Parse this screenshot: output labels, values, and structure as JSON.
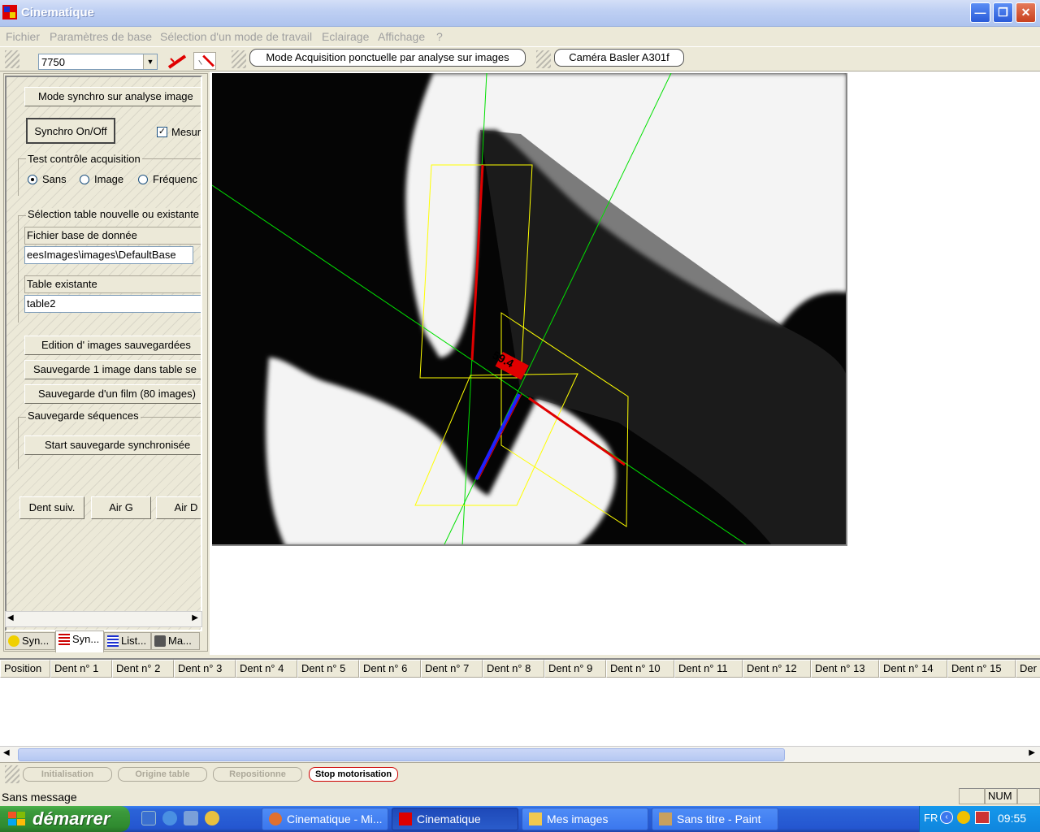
{
  "window": {
    "title": "Cinematique"
  },
  "menu": [
    "Fichier",
    "Paramètres de base",
    "Sélection d'un mode de travail",
    "Eclairage",
    "Affichage",
    "?"
  ],
  "toolbar": {
    "combo_value": "7750",
    "mode_button": "Mode Acquisition ponctuelle par analyse sur images",
    "camera_button": "Caméra Basler A301f"
  },
  "left_panel": {
    "mode_synchro_button": "Mode synchro sur analyse image",
    "synchro_toggle": "Synchro On/Off",
    "mesure_check": "Mesur",
    "test_group": "Test contrôle acquisition",
    "radio_sans": "Sans",
    "radio_image": "Image",
    "radio_frequence": "Fréquenc",
    "selection_group": "Sélection table nouvelle ou existante",
    "db_file_label": "Fichier base de donnée",
    "db_file_value": "eesImages\\images\\DefaultBase",
    "table_label": "Table existante",
    "table_value": "table2",
    "edition_button": "Edition d' images sauvegardées",
    "save_one_button": "Sauvegarde 1 image dans table se",
    "save_film_button": "Sauvegarde d'un film (80 images)",
    "seq_group": "Sauvegarde séquences",
    "start_save_button": "Start sauvegarde synchronisée",
    "dent_suiv_button": "Dent suiv.",
    "air_g_button": "Air G",
    "air_d_button": "Air D"
  },
  "tabs": [
    "Syn...",
    "Syn...",
    "List...",
    "Ma..."
  ],
  "camera": {
    "angle_label": "59.4"
  },
  "table": {
    "columns": [
      "Position",
      "Dent n° 1",
      "Dent n° 2",
      "Dent n° 3",
      "Dent n° 4",
      "Dent n° 5",
      "Dent n° 6",
      "Dent n° 7",
      "Dent n° 8",
      "Dent n° 9",
      "Dent n° 10",
      "Dent n° 11",
      "Dent n° 12",
      "Dent n° 13",
      "Dent n° 14",
      "Dent n° 15",
      "Der"
    ]
  },
  "motor": {
    "init": "Initialisation",
    "origin": "Origine table",
    "reposition": "Repositionne",
    "stop": "Stop motorisation"
  },
  "status": {
    "message": "Sans message",
    "num": "NUM"
  },
  "taskbar": {
    "start": "démarrer",
    "tasks": [
      "Cinematique - Mi...",
      "Cinematique",
      "Mes images",
      "Sans titre - Paint"
    ],
    "lang": "FR",
    "clock": "09:55"
  },
  "colors": {
    "accent_red": "#e00000",
    "overlay_yellow": "#ffff00",
    "overlay_green": "#00e000",
    "overlay_blue": "#2020ff"
  }
}
